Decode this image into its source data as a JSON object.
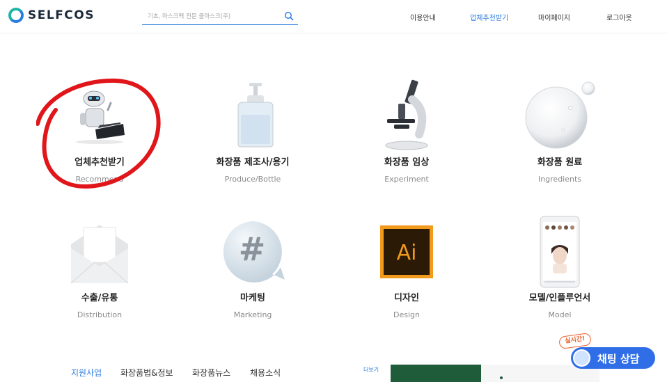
{
  "header": {
    "logo_text": "SELFCOS",
    "search": {
      "placeholder": "기초, 마스크팩 전문 클마스크(주)"
    },
    "nav": [
      {
        "label": "이용안내",
        "active": false
      },
      {
        "label": "업체추천받기",
        "active": true
      },
      {
        "label": "마이페이지",
        "active": false
      },
      {
        "label": "로그아웃",
        "active": false
      }
    ]
  },
  "categories": [
    {
      "title": "업체추천받기",
      "sub": "Recommend",
      "icon": "robot-laptop-icon"
    },
    {
      "title": "화장품 제조사/용기",
      "sub": "Produce/Bottle",
      "icon": "pump-bottle-icon"
    },
    {
      "title": "화장품 임상",
      "sub": "Experiment",
      "icon": "microscope-icon"
    },
    {
      "title": "화장품 원료",
      "sub": "Ingredients",
      "icon": "bubble-icon"
    },
    {
      "title": "수출/유통",
      "sub": "Distribution",
      "icon": "envelope-icon"
    },
    {
      "title": "마케팅",
      "sub": "Marketing",
      "icon": "hashtag-bubble-icon"
    },
    {
      "title": "디자인",
      "sub": "Design",
      "icon": "illustrator-icon"
    },
    {
      "title": "모델/인플루언서",
      "sub": "Model",
      "icon": "phone-model-icon"
    }
  ],
  "illustrator_text": "Ai",
  "hashtag_text": "#",
  "bottom_tabs": [
    {
      "label": "지원사업",
      "active": true
    },
    {
      "label": "화장품법&정보",
      "active": false
    },
    {
      "label": "화장품뉴스",
      "active": false
    },
    {
      "label": "채용소식",
      "active": false
    }
  ],
  "more_label": "더보기",
  "chat": {
    "label": "채팅 상담",
    "badge": "실시간!"
  },
  "colors": {
    "accent": "#2f7de0",
    "highlight": "#e0161b",
    "chat": "#2f6ee6",
    "banner": "#1f5c3a"
  }
}
